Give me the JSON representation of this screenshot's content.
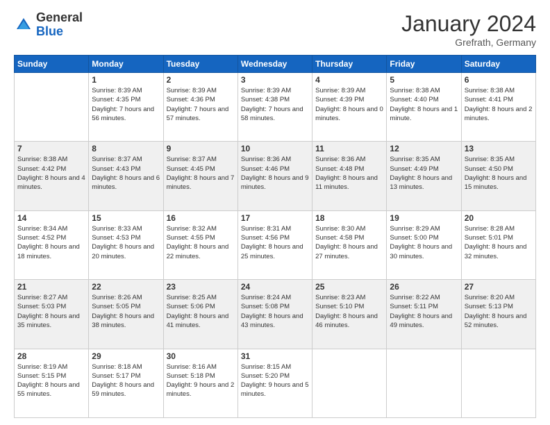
{
  "header": {
    "logo": {
      "general": "General",
      "blue": "Blue"
    },
    "title": "January 2024",
    "location": "Grefrath, Germany"
  },
  "calendar": {
    "headers": [
      "Sunday",
      "Monday",
      "Tuesday",
      "Wednesday",
      "Thursday",
      "Friday",
      "Saturday"
    ],
    "rows": [
      {
        "shaded": false,
        "cells": [
          {
            "day": "",
            "empty": true
          },
          {
            "day": "1",
            "sunrise": "Sunrise: 8:39 AM",
            "sunset": "Sunset: 4:35 PM",
            "daylight": "Daylight: 7 hours and 56 minutes."
          },
          {
            "day": "2",
            "sunrise": "Sunrise: 8:39 AM",
            "sunset": "Sunset: 4:36 PM",
            "daylight": "Daylight: 7 hours and 57 minutes."
          },
          {
            "day": "3",
            "sunrise": "Sunrise: 8:39 AM",
            "sunset": "Sunset: 4:38 PM",
            "daylight": "Daylight: 7 hours and 58 minutes."
          },
          {
            "day": "4",
            "sunrise": "Sunrise: 8:39 AM",
            "sunset": "Sunset: 4:39 PM",
            "daylight": "Daylight: 8 hours and 0 minutes."
          },
          {
            "day": "5",
            "sunrise": "Sunrise: 8:38 AM",
            "sunset": "Sunset: 4:40 PM",
            "daylight": "Daylight: 8 hours and 1 minute."
          },
          {
            "day": "6",
            "sunrise": "Sunrise: 8:38 AM",
            "sunset": "Sunset: 4:41 PM",
            "daylight": "Daylight: 8 hours and 2 minutes."
          }
        ]
      },
      {
        "shaded": true,
        "cells": [
          {
            "day": "7",
            "sunrise": "Sunrise: 8:38 AM",
            "sunset": "Sunset: 4:42 PM",
            "daylight": "Daylight: 8 hours and 4 minutes."
          },
          {
            "day": "8",
            "sunrise": "Sunrise: 8:37 AM",
            "sunset": "Sunset: 4:43 PM",
            "daylight": "Daylight: 8 hours and 6 minutes."
          },
          {
            "day": "9",
            "sunrise": "Sunrise: 8:37 AM",
            "sunset": "Sunset: 4:45 PM",
            "daylight": "Daylight: 8 hours and 7 minutes."
          },
          {
            "day": "10",
            "sunrise": "Sunrise: 8:36 AM",
            "sunset": "Sunset: 4:46 PM",
            "daylight": "Daylight: 8 hours and 9 minutes."
          },
          {
            "day": "11",
            "sunrise": "Sunrise: 8:36 AM",
            "sunset": "Sunset: 4:48 PM",
            "daylight": "Daylight: 8 hours and 11 minutes."
          },
          {
            "day": "12",
            "sunrise": "Sunrise: 8:35 AM",
            "sunset": "Sunset: 4:49 PM",
            "daylight": "Daylight: 8 hours and 13 minutes."
          },
          {
            "day": "13",
            "sunrise": "Sunrise: 8:35 AM",
            "sunset": "Sunset: 4:50 PM",
            "daylight": "Daylight: 8 hours and 15 minutes."
          }
        ]
      },
      {
        "shaded": false,
        "cells": [
          {
            "day": "14",
            "sunrise": "Sunrise: 8:34 AM",
            "sunset": "Sunset: 4:52 PM",
            "daylight": "Daylight: 8 hours and 18 minutes."
          },
          {
            "day": "15",
            "sunrise": "Sunrise: 8:33 AM",
            "sunset": "Sunset: 4:53 PM",
            "daylight": "Daylight: 8 hours and 20 minutes."
          },
          {
            "day": "16",
            "sunrise": "Sunrise: 8:32 AM",
            "sunset": "Sunset: 4:55 PM",
            "daylight": "Daylight: 8 hours and 22 minutes."
          },
          {
            "day": "17",
            "sunrise": "Sunrise: 8:31 AM",
            "sunset": "Sunset: 4:56 PM",
            "daylight": "Daylight: 8 hours and 25 minutes."
          },
          {
            "day": "18",
            "sunrise": "Sunrise: 8:30 AM",
            "sunset": "Sunset: 4:58 PM",
            "daylight": "Daylight: 8 hours and 27 minutes."
          },
          {
            "day": "19",
            "sunrise": "Sunrise: 8:29 AM",
            "sunset": "Sunset: 5:00 PM",
            "daylight": "Daylight: 8 hours and 30 minutes."
          },
          {
            "day": "20",
            "sunrise": "Sunrise: 8:28 AM",
            "sunset": "Sunset: 5:01 PM",
            "daylight": "Daylight: 8 hours and 32 minutes."
          }
        ]
      },
      {
        "shaded": true,
        "cells": [
          {
            "day": "21",
            "sunrise": "Sunrise: 8:27 AM",
            "sunset": "Sunset: 5:03 PM",
            "daylight": "Daylight: 8 hours and 35 minutes."
          },
          {
            "day": "22",
            "sunrise": "Sunrise: 8:26 AM",
            "sunset": "Sunset: 5:05 PM",
            "daylight": "Daylight: 8 hours and 38 minutes."
          },
          {
            "day": "23",
            "sunrise": "Sunrise: 8:25 AM",
            "sunset": "Sunset: 5:06 PM",
            "daylight": "Daylight: 8 hours and 41 minutes."
          },
          {
            "day": "24",
            "sunrise": "Sunrise: 8:24 AM",
            "sunset": "Sunset: 5:08 PM",
            "daylight": "Daylight: 8 hours and 43 minutes."
          },
          {
            "day": "25",
            "sunrise": "Sunrise: 8:23 AM",
            "sunset": "Sunset: 5:10 PM",
            "daylight": "Daylight: 8 hours and 46 minutes."
          },
          {
            "day": "26",
            "sunrise": "Sunrise: 8:22 AM",
            "sunset": "Sunset: 5:11 PM",
            "daylight": "Daylight: 8 hours and 49 minutes."
          },
          {
            "day": "27",
            "sunrise": "Sunrise: 8:20 AM",
            "sunset": "Sunset: 5:13 PM",
            "daylight": "Daylight: 8 hours and 52 minutes."
          }
        ]
      },
      {
        "shaded": false,
        "cells": [
          {
            "day": "28",
            "sunrise": "Sunrise: 8:19 AM",
            "sunset": "Sunset: 5:15 PM",
            "daylight": "Daylight: 8 hours and 55 minutes."
          },
          {
            "day": "29",
            "sunrise": "Sunrise: 8:18 AM",
            "sunset": "Sunset: 5:17 PM",
            "daylight": "Daylight: 8 hours and 59 minutes."
          },
          {
            "day": "30",
            "sunrise": "Sunrise: 8:16 AM",
            "sunset": "Sunset: 5:18 PM",
            "daylight": "Daylight: 9 hours and 2 minutes."
          },
          {
            "day": "31",
            "sunrise": "Sunrise: 8:15 AM",
            "sunset": "Sunset: 5:20 PM",
            "daylight": "Daylight: 9 hours and 5 minutes."
          },
          {
            "day": "",
            "empty": true
          },
          {
            "day": "",
            "empty": true
          },
          {
            "day": "",
            "empty": true
          }
        ]
      }
    ]
  }
}
